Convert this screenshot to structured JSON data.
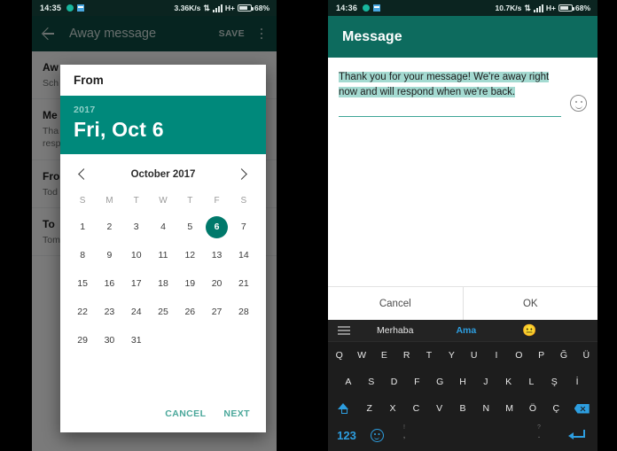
{
  "left": {
    "statusbar": {
      "time": "14:35",
      "speed": "3.36K/s",
      "network": "H+",
      "battery": "68%"
    },
    "appbar": {
      "title": "Away message",
      "save_label": "SAVE"
    },
    "list": [
      {
        "title": "Aw",
        "sub": "Sch"
      },
      {
        "title": "Me",
        "sub": "Tha\nresp"
      },
      {
        "title": "Fro",
        "sub": "Tod"
      },
      {
        "title": "To",
        "sub": "Tom"
      }
    ],
    "dialog": {
      "label": "From",
      "year": "2017",
      "date": "Fri, Oct 6",
      "month_title": "October 2017",
      "dow": [
        "S",
        "M",
        "T",
        "W",
        "T",
        "F",
        "S"
      ],
      "lead_blanks": 0,
      "days": [
        1,
        2,
        3,
        4,
        5,
        6,
        7,
        8,
        9,
        10,
        11,
        12,
        13,
        14,
        15,
        16,
        17,
        18,
        19,
        20,
        21,
        22,
        23,
        24,
        25,
        26,
        27,
        28,
        29,
        30,
        31
      ],
      "selected_day": 6,
      "cancel_label": "CANCEL",
      "next_label": "NEXT"
    }
  },
  "right": {
    "statusbar": {
      "time": "14:36",
      "speed": "10.7K/s",
      "network": "H+",
      "battery": "68%"
    },
    "appbar": {
      "title": "Message"
    },
    "message": {
      "text": "Thank you for your message! We're away right now and will respond when we're back.",
      "emoji_icon": "emoji-outline-icon"
    },
    "actions": {
      "cancel_label": "Cancel",
      "ok_label": "OK"
    },
    "keyboard": {
      "suggestions": [
        "Merhaba",
        "Ama"
      ],
      "suggestion_emoji": "😐",
      "row1": [
        "Q",
        "W",
        "E",
        "R",
        "T",
        "Y",
        "U",
        "I",
        "O",
        "P",
        "Ğ",
        "Ü"
      ],
      "row2": [
        "A",
        "S",
        "D",
        "F",
        "G",
        "H",
        "J",
        "K",
        "L",
        "Ş",
        "İ"
      ],
      "row3": [
        "Z",
        "X",
        "C",
        "V",
        "B",
        "N",
        "M",
        "Ö",
        "Ç"
      ],
      "numeric_label": "123",
      "comma": ",",
      "comma_alt": "!",
      "period": ".",
      "period_alt": "?"
    }
  },
  "colors": {
    "appbar_dark": "#0d4d43",
    "dialog_header": "#00897b",
    "selection_circle": "#00796b",
    "text_highlight": "#a4dad1",
    "accent_blue": "#2d9ee0"
  }
}
